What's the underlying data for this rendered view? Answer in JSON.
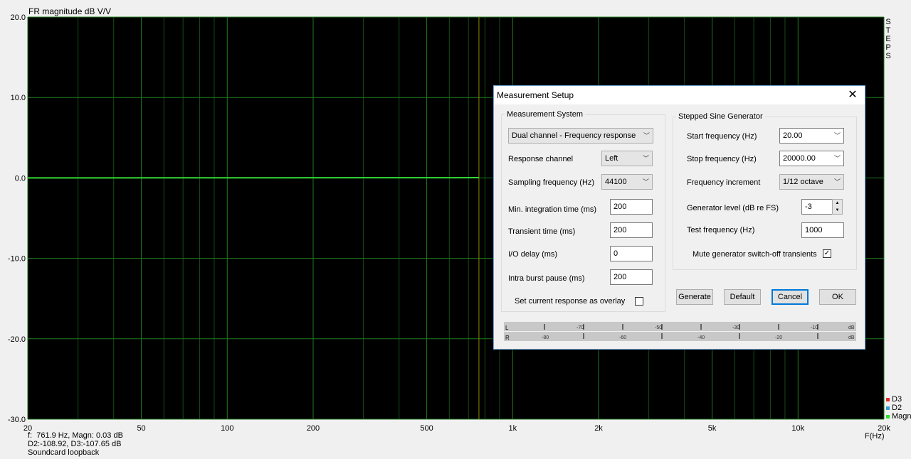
{
  "plot": {
    "title": "FR magnitude dB V/V",
    "steps_label": "STEPS",
    "x_unit": "F(Hz)",
    "cursor_line1": "f:  761.9 Hz, Magn: 0.03 dB",
    "cursor_line2": "D2:-108.92, D3:-107.65 dB",
    "cursor_line3": "Soundcard loopback",
    "legend": [
      {
        "label": "D3",
        "color": "#e03030"
      },
      {
        "label": "D2",
        "color": "#3aa0d0"
      },
      {
        "label": "Magn",
        "color": "#33dd33"
      }
    ]
  },
  "chart_data": {
    "type": "line",
    "xscale": "log",
    "xlim": [
      20,
      20000
    ],
    "ylim": [
      -30,
      20
    ],
    "y_ticks": [
      "20.0",
      "10.0",
      "0.0",
      "-10.0",
      "-20.0",
      "-30.0"
    ],
    "x_ticks": [
      "20",
      "50",
      "100",
      "200",
      "500",
      "1k",
      "2k",
      "5k",
      "10k",
      "20k"
    ],
    "ylabel": "FR magnitude dB V/V",
    "xlabel": "F(Hz)",
    "grid": true,
    "background": "#000000",
    "cursor_x": 761.9,
    "series": [
      {
        "name": "Magn",
        "color": "#33dd33",
        "x": [
          20,
          761.9
        ],
        "y": [
          0.0,
          0.03
        ]
      }
    ]
  },
  "dialog": {
    "title": "Measurement Setup",
    "measurement_system": {
      "group_label": "Measurement System",
      "mode": "Dual channel - Frequency response",
      "response_channel_label": "Response channel",
      "response_channel": "Left",
      "sampling_label": "Sampling frequency (Hz)",
      "sampling": "44100",
      "min_integration_label": "Min. integration time (ms)",
      "min_integration": "200",
      "transient_label": "Transient time (ms)",
      "transient": "200",
      "io_delay_label": "I/O delay (ms)",
      "io_delay": "0",
      "intra_burst_label": "Intra burst pause (ms)",
      "intra_burst": "200",
      "overlay_label": "Set current response as overlay",
      "overlay_checked": false
    },
    "generator": {
      "group_label": "Stepped Sine Generator",
      "start_label": "Start frequency (Hz)",
      "start": "20.00",
      "stop_label": "Stop frequency (Hz)",
      "stop": "20000.00",
      "increment_label": "Frequency increment",
      "increment": "1/12 octave",
      "level_label": "Generator level (dB re FS)",
      "level": "-3",
      "test_label": "Test frequency (Hz)",
      "test": "1000",
      "mute_label": "Mute generator switch-off transients",
      "mute_checked": true
    },
    "buttons": {
      "generate": "Generate",
      "default": "Default",
      "cancel": "Cancel",
      "ok": "OK"
    },
    "meter": {
      "left_label": "L",
      "right_label": "R",
      "top_ticks": [
        "-70",
        "-50",
        "-30",
        "-10",
        "dB"
      ],
      "bottom_ticks": [
        "-80",
        "-60",
        "-40",
        "-20",
        "dB"
      ]
    }
  }
}
